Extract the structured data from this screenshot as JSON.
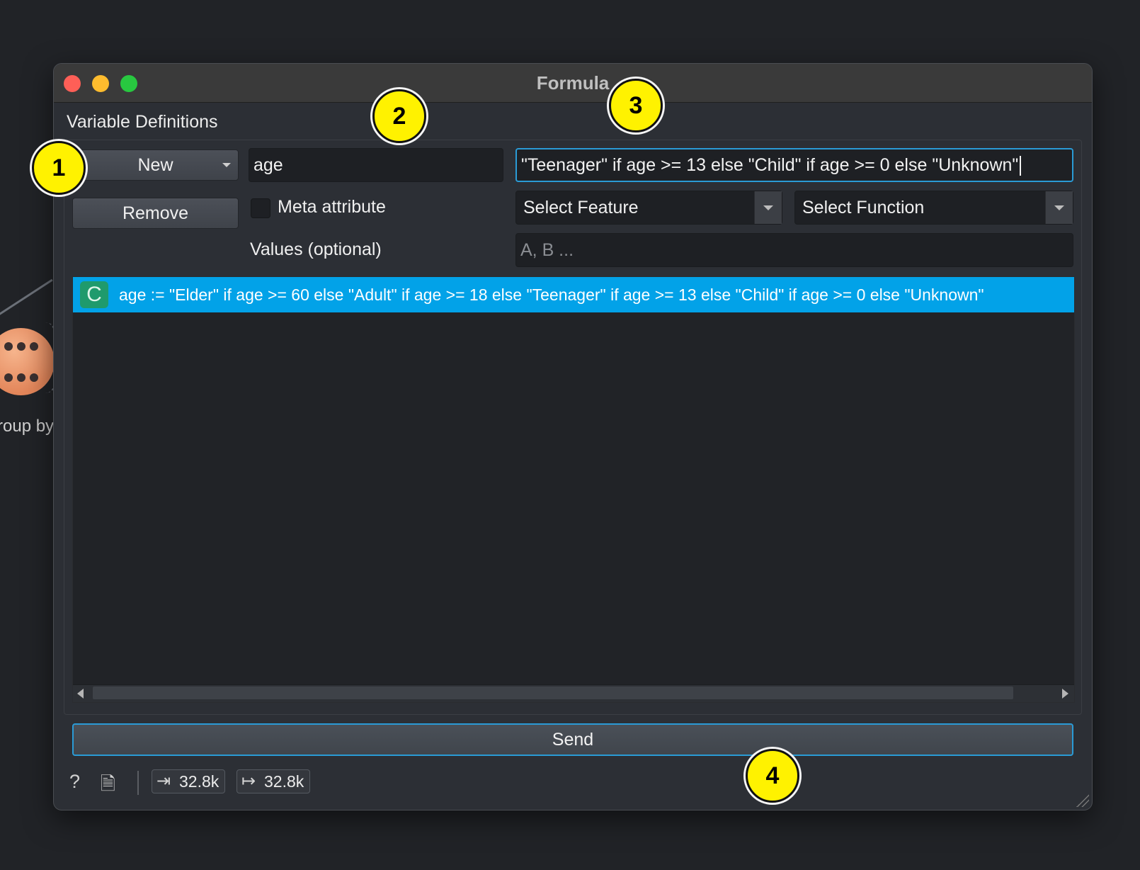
{
  "background": {
    "widget_label": "roup by"
  },
  "window": {
    "title": "Formula",
    "section_label": "Variable Definitions",
    "buttons": {
      "new_label": "New",
      "remove_label": "Remove",
      "send_label": "Send"
    },
    "name_field_value": "age",
    "expression_value": "\"Teenager\" if age >= 13 else \"Child\" if age >= 0 else \"Unknown\"",
    "meta_attribute_label": "Meta attribute",
    "values_label": "Values (optional)",
    "values_placeholder": "A, B ...",
    "select_feature": "Select Feature",
    "select_function": "Select Function",
    "definitions": [
      {
        "type_badge": "C",
        "text": "age := \"Elder\" if age >= 60 else \"Adult\" if age >= 18 else \"Teenager\" if age >= 13 else \"Child\" if age >= 0 else \"Unknown\""
      }
    ],
    "status": {
      "input_count": "32.8k",
      "output_count": "32.8k"
    }
  },
  "annotations": [
    "1",
    "2",
    "3",
    "4"
  ],
  "colors": {
    "accent": "#02a2e8",
    "marker": "#fff200",
    "badge": "#1f9a6c"
  }
}
